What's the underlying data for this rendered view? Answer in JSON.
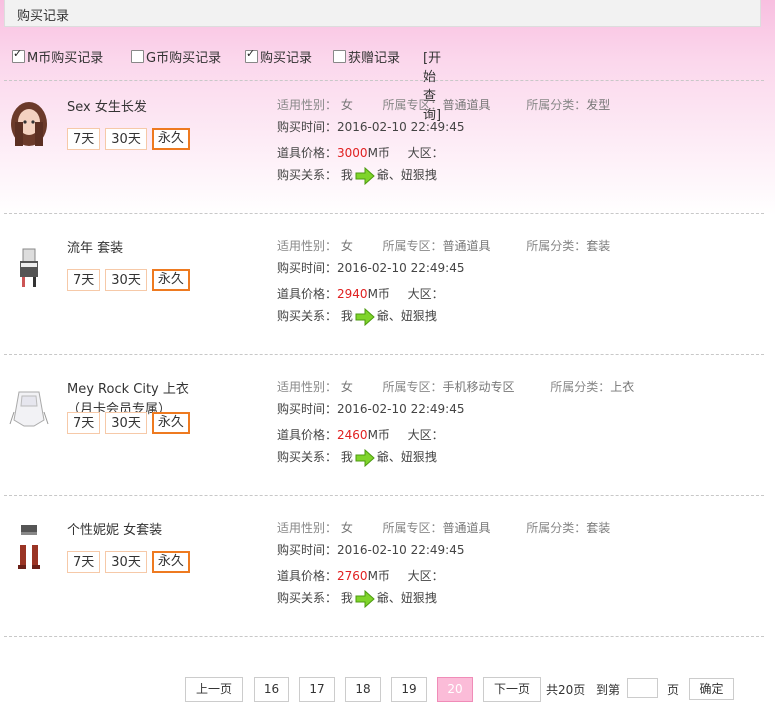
{
  "header": {
    "title": "购买记录"
  },
  "filters": {
    "m_coin": {
      "label": "M币购买记录",
      "checked": true
    },
    "g_coin": {
      "label": "G币购买记录",
      "checked": false
    },
    "purchase": {
      "label": "购买记录",
      "checked": true
    },
    "gift": {
      "label": "获赠记录",
      "checked": false
    },
    "query_label": "[开始查询]"
  },
  "labels": {
    "gender": "适用性别：",
    "zone": "所属专区：",
    "category": "所属分类：",
    "time": "购买时间：",
    "price": "道具价格：",
    "currency": "M币",
    "region": "大区：",
    "relation": "购买关系：",
    "me": "我"
  },
  "durations": [
    "7天",
    "30天",
    "永久"
  ],
  "items": [
    {
      "name": "Sex 女生长发",
      "name2": "",
      "gender": "女",
      "zone": "普通道具",
      "category": "发型",
      "time": "2016-02-10 22:49:45",
      "price": "3000",
      "region": "",
      "recipient": "爺、妞狠拽"
    },
    {
      "name": "流年 套装",
      "name2": "",
      "gender": "女",
      "zone": "普通道具",
      "category": "套装",
      "time": "2016-02-10 22:49:45",
      "price": "2940",
      "region": "",
      "recipient": "爺、妞狠拽"
    },
    {
      "name": "Mey Rock City 上衣",
      "name2": "（月卡会员专属）",
      "gender": "女",
      "zone": "手机移动专区",
      "category": "上衣",
      "time": "2016-02-10 22:49:45",
      "price": "2460",
      "region": "",
      "recipient": "爺、妞狠拽"
    },
    {
      "name": "个性妮妮 女套装",
      "name2": "",
      "gender": "女",
      "zone": "普通道具",
      "category": "套装",
      "time": "2016-02-10 22:49:45",
      "price": "2760",
      "region": "",
      "recipient": "爺、妞狠拽"
    }
  ],
  "pagination": {
    "prev": "上一页",
    "pages": [
      "16",
      "17",
      "18",
      "19",
      "20"
    ],
    "current": "20",
    "next": "下一页",
    "total": "共20页",
    "goto_prefix": "到第",
    "goto_suffix": "页",
    "goto_value": "",
    "confirm": "确定"
  },
  "colors": {
    "accent_orange": "#ee7a20",
    "price_red": "#e02020",
    "current_page_pink": "#fbbcd8"
  }
}
